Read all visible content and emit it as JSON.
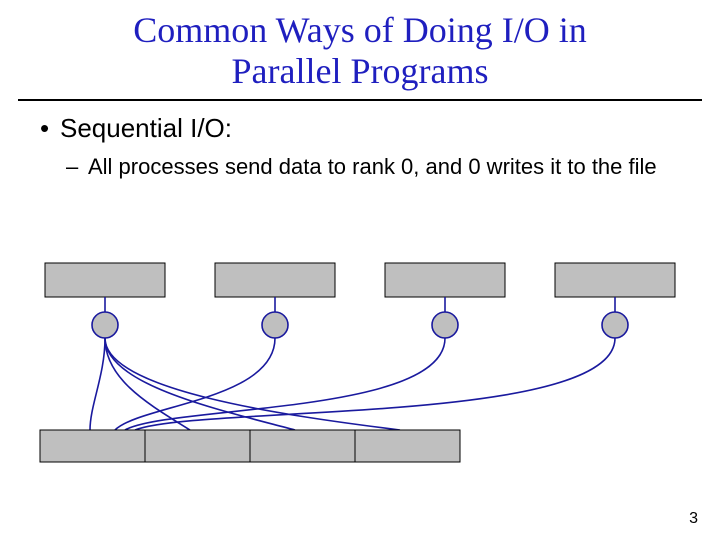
{
  "title_line1": "Common Ways of Doing I/O in",
  "title_line2": "Parallel Programs",
  "bullet1": "Sequential I/O:",
  "sub1": "All processes send data to rank 0, and 0 writes it to the file",
  "page_number": "3",
  "diagram": {
    "top_boxes": 4,
    "circles": 4,
    "file_segments": 4,
    "colors": {
      "box_fill": "#bfbfbf",
      "stroke": "#1a1a9e"
    }
  }
}
